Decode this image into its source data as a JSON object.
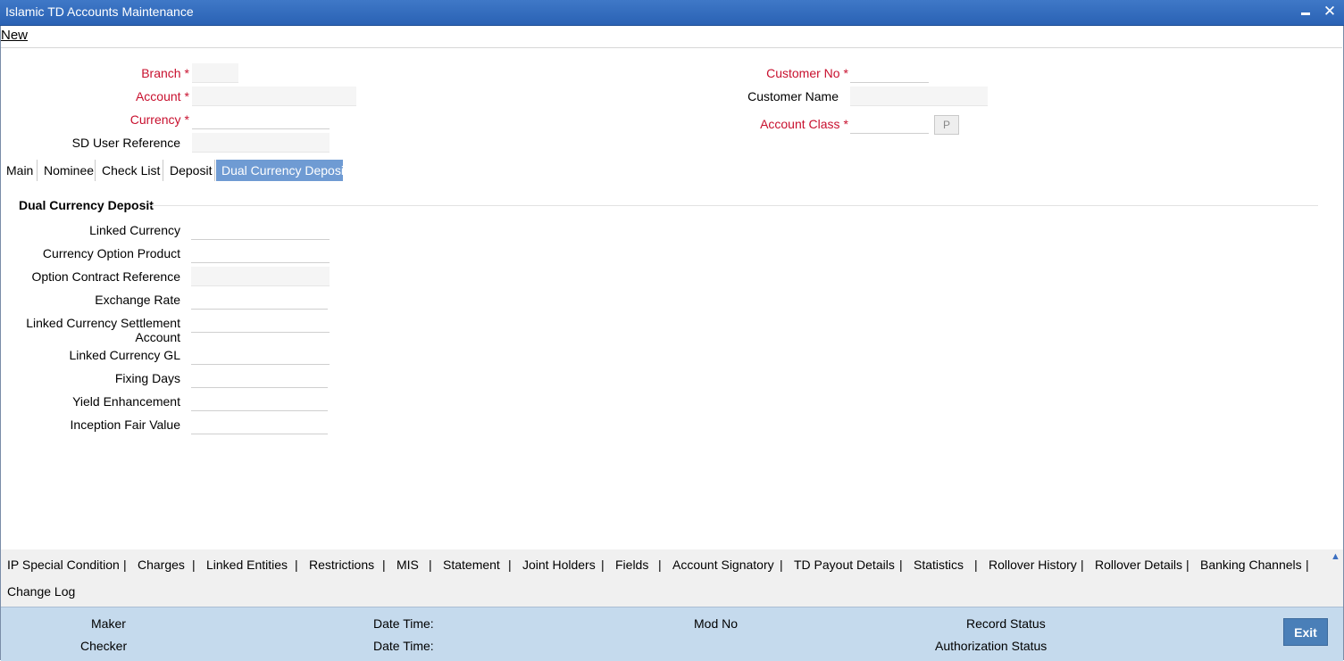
{
  "window": {
    "title": "Islamic TD Accounts Maintenance",
    "minimize_label": "",
    "close_label": "✕"
  },
  "menu": {
    "new_label": "New"
  },
  "header_fields": {
    "branch": {
      "label": "Branch",
      "value": ""
    },
    "account": {
      "label": "Account",
      "value": ""
    },
    "currency": {
      "label": "Currency",
      "value": ""
    },
    "sd_user_reference": {
      "label": "SD User Reference",
      "value": ""
    },
    "customer_no": {
      "label": "Customer No",
      "value": ""
    },
    "customer_name": {
      "label": "Customer Name",
      "value": ""
    },
    "account_class": {
      "label": "Account Class",
      "value": ""
    },
    "p_button": "P",
    "required_marker": "*"
  },
  "tabs": [
    {
      "label": "Main"
    },
    {
      "label": "Nominee"
    },
    {
      "label": "Check List"
    },
    {
      "label": "Deposit"
    },
    {
      "label": "Dual Currency Deposit"
    }
  ],
  "section": {
    "title": "Dual Currency Deposit",
    "fields": [
      {
        "label": "Linked Currency",
        "value": ""
      },
      {
        "label": "Currency Option Product",
        "value": ""
      },
      {
        "label": "Option Contract Reference",
        "value": ""
      },
      {
        "label": "Exchange Rate",
        "value": ""
      },
      {
        "label_line1": "Linked Currency Settlement",
        "label_line2": "Account",
        "value": ""
      },
      {
        "label": "Linked Currency GL",
        "value": ""
      },
      {
        "label": "Fixing Days",
        "value": ""
      },
      {
        "label": "Yield Enhancement",
        "value": ""
      },
      {
        "label": "Inception Fair Value",
        "value": ""
      }
    ]
  },
  "bottom_links": [
    "IP Special Condition",
    "Charges",
    "Linked Entities",
    "Restrictions",
    "MIS",
    "Statement",
    "Joint Holders",
    "Fields",
    "Account Signatory",
    "TD Payout Details",
    "Statistics",
    "Rollover History",
    "Rollover Details",
    "Banking Channels",
    "Change Log"
  ],
  "link_separator": "|",
  "footer": {
    "maker": "Maker",
    "checker": "Checker",
    "date_time_1": "Date Time:",
    "date_time_2": "Date Time:",
    "mod_no": "Mod No",
    "record_status": "Record Status",
    "authorization_status": "Authorization Status",
    "exit_label": "Exit"
  },
  "colors": {
    "titlebar": "#2f68b8",
    "active_tab": "#6f9bd3",
    "footer": "#c5daed",
    "required": "#c8102e",
    "exit_button": "#4a7fb8"
  }
}
